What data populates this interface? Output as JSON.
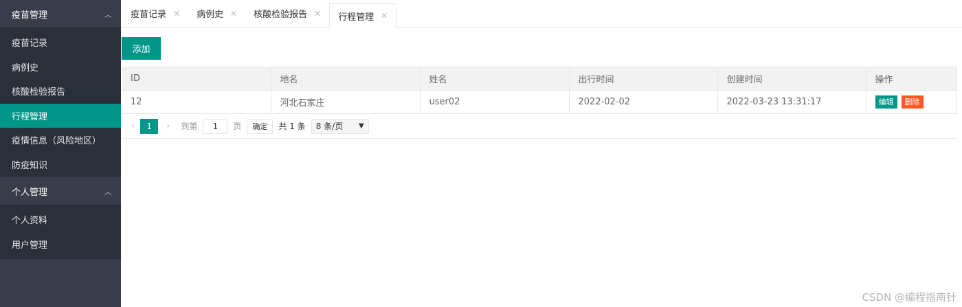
{
  "sidebar": {
    "groups": [
      {
        "title": "疫苗管理",
        "items": [
          "疫苗记录",
          "病例史",
          "核酸检验报告",
          "行程管理",
          "疫情信息（风险地区）",
          "防疫知识"
        ]
      },
      {
        "title": "个人管理",
        "items": [
          "个人资料",
          "用户管理"
        ]
      }
    ]
  },
  "tabs": [
    {
      "label": "疫苗记录"
    },
    {
      "label": "病例史"
    },
    {
      "label": "核酸检验报告"
    },
    {
      "label": "行程管理"
    }
  ],
  "toolbar": {
    "add_label": "添加"
  },
  "table": {
    "columns": [
      "ID",
      "地名",
      "姓名",
      "出行时间",
      "创建时间",
      "操作"
    ],
    "rows": [
      {
        "id": "12",
        "place": "河北石家庄",
        "name": "user02",
        "travel_time": "2022-02-02",
        "created_time": "2022-03-23 13:31:17",
        "edit_label": "编辑",
        "delete_label": "删除"
      }
    ]
  },
  "pager": {
    "current_page": "1",
    "goto_label": "到第",
    "goto_value": "1",
    "page_unit": "页",
    "confirm_label": "确定",
    "total_label": "共 1 条",
    "page_size": "8 条/页"
  },
  "watermark": "CSDN @编程指南针",
  "colors": {
    "accent": "#009688",
    "danger": "#ff5722",
    "sidebar": "#393d49"
  }
}
